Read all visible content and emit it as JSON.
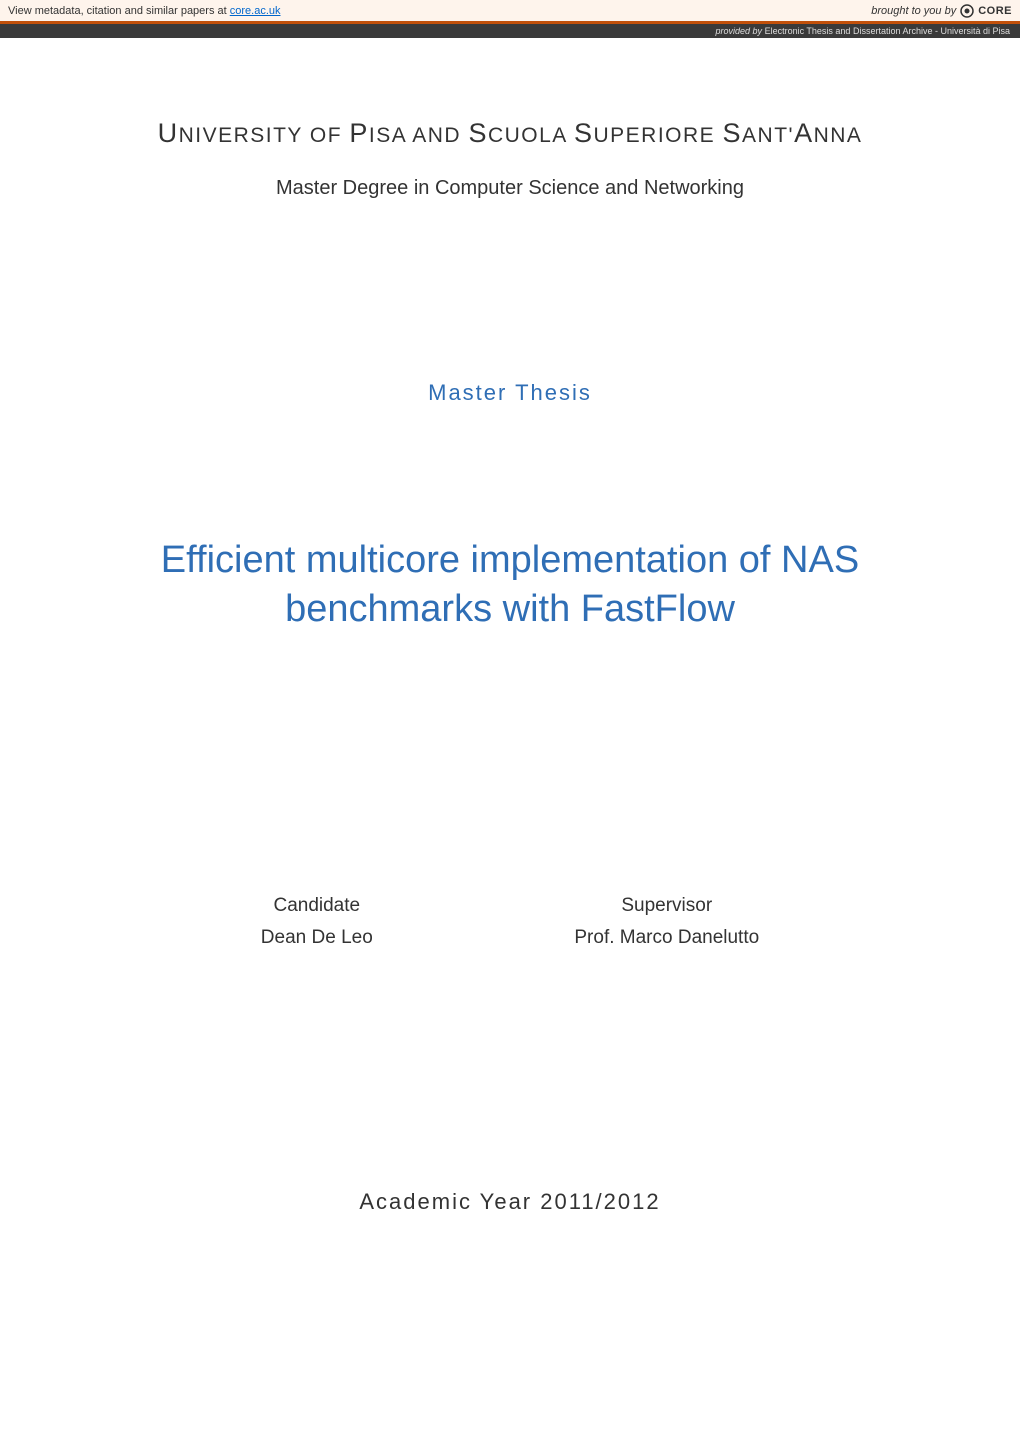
{
  "banner": {
    "left_prefix": "View metadata, citation and similar papers at ",
    "link_text": "core.ac.uk",
    "right_prefix": "brought to you by ",
    "brand": "CORE"
  },
  "provider": {
    "prefix": "provided by ",
    "archive": "Electronic Thesis and Dissertation Archive - Università di Pisa"
  },
  "document": {
    "university": "UNIVERSITY OF PISA AND SCUOLA SUPERIORE SANT'ANNA",
    "degree": "Master Degree in Computer Science and Networking",
    "thesis_label": "Master Thesis",
    "title": "Efficient multicore implementation of NAS benchmarks with FastFlow",
    "candidate": {
      "role": "Candidate",
      "name": "Dean De Leo"
    },
    "supervisor": {
      "role": "Supervisor",
      "name": "Prof. Marco Danelutto"
    },
    "academic_year": "Academic Year 2011/2012"
  }
}
